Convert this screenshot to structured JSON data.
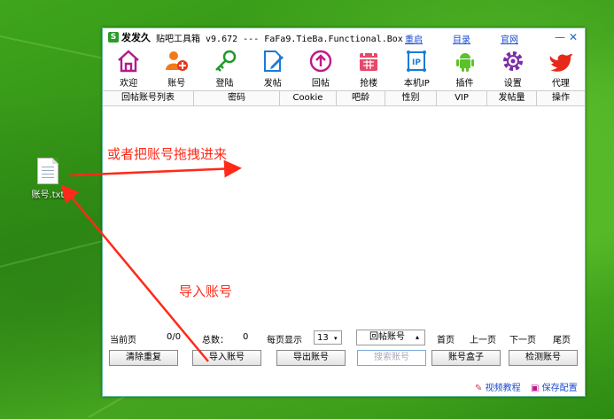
{
  "desktop": {
    "file_label": "账号.txt"
  },
  "window": {
    "app_name": "发发久",
    "subtitle": "贴吧工具箱 v9.672 --- FaFa9.TieBa.Functional.Box",
    "links": [
      "重启",
      "目录",
      "官网"
    ],
    "colors": {
      "link": "#1a4cd0",
      "annotation": "#ff2a1a",
      "accent": "#2a9c2a"
    }
  },
  "toolbar": [
    {
      "label": "欢迎",
      "icon": "home-icon"
    },
    {
      "label": "账号",
      "icon": "user-add-icon"
    },
    {
      "label": "登陆",
      "icon": "key-icon"
    },
    {
      "label": "发帖",
      "icon": "edit-doc-icon"
    },
    {
      "label": "回帖",
      "icon": "reply-icon"
    },
    {
      "label": "抢楼",
      "icon": "calendar-icon"
    },
    {
      "label": "本机IP",
      "icon": "ip-icon"
    },
    {
      "label": "插件",
      "icon": "android-icon"
    },
    {
      "label": "设置",
      "icon": "gear-icon"
    },
    {
      "label": "代理",
      "icon": "bird-icon"
    }
  ],
  "table": {
    "headers": [
      "回帖账号列表",
      "密码",
      "Cookie",
      "吧龄",
      "性别",
      "VIP",
      "发帖量",
      "操作"
    ]
  },
  "pager": {
    "current_label": "当前页",
    "current_value": "0/0",
    "total_label": "总数：",
    "total_value": "0",
    "per_page_label": "每页显示",
    "per_page_value": "13",
    "account_type": "回帖账号",
    "first": "首页",
    "prev": "上一页",
    "next": "下一页",
    "last": "尾页"
  },
  "buttons": {
    "clear_dup": "清除重复",
    "import": "导入账号",
    "export": "导出账号",
    "search_placeholder": "搜索账号",
    "box": "账号盒子",
    "check": "检测账号"
  },
  "footer": {
    "video": "视频教程",
    "save": "保存配置"
  },
  "annotations": {
    "drag_hint": "或者把账号拖拽进来",
    "import_hint": "导入账号"
  }
}
